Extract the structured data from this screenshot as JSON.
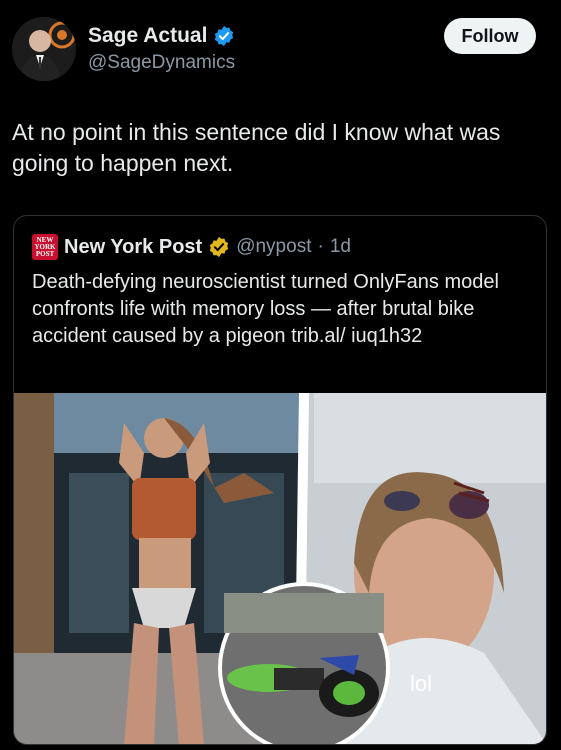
{
  "author": {
    "name": "Sage Actual",
    "handle": "@SageDynamics",
    "follow_label": "Follow",
    "verified": true
  },
  "tweet": {
    "text": "At no point in this sentence did I know what was going to happen next."
  },
  "quoted": {
    "logo_text": "NEW YORK POST",
    "name": "New York Post",
    "handle": "@nypost",
    "separator": "·",
    "time": "1d",
    "text": "Death-defying neuroscientist turned OnlyFans model confronts life with memory loss — after brutal bike accident caused by a pigeon trib.al/ iuq1h32",
    "image_caption_left": "",
    "image_overlay_text": "lol"
  },
  "colors": {
    "background": "#000000",
    "text": "#e7e9ea",
    "muted": "#8b98a5",
    "verified_blue": "#1d9bf0",
    "verified_gold": "#e2b719",
    "follow_bg": "#eff3f4",
    "nyp_red": "#c8102e",
    "border": "#2f3336"
  },
  "icons": {
    "author_verified": "verified-badge-blue-icon",
    "quoted_verified": "verified-badge-gold-icon"
  }
}
